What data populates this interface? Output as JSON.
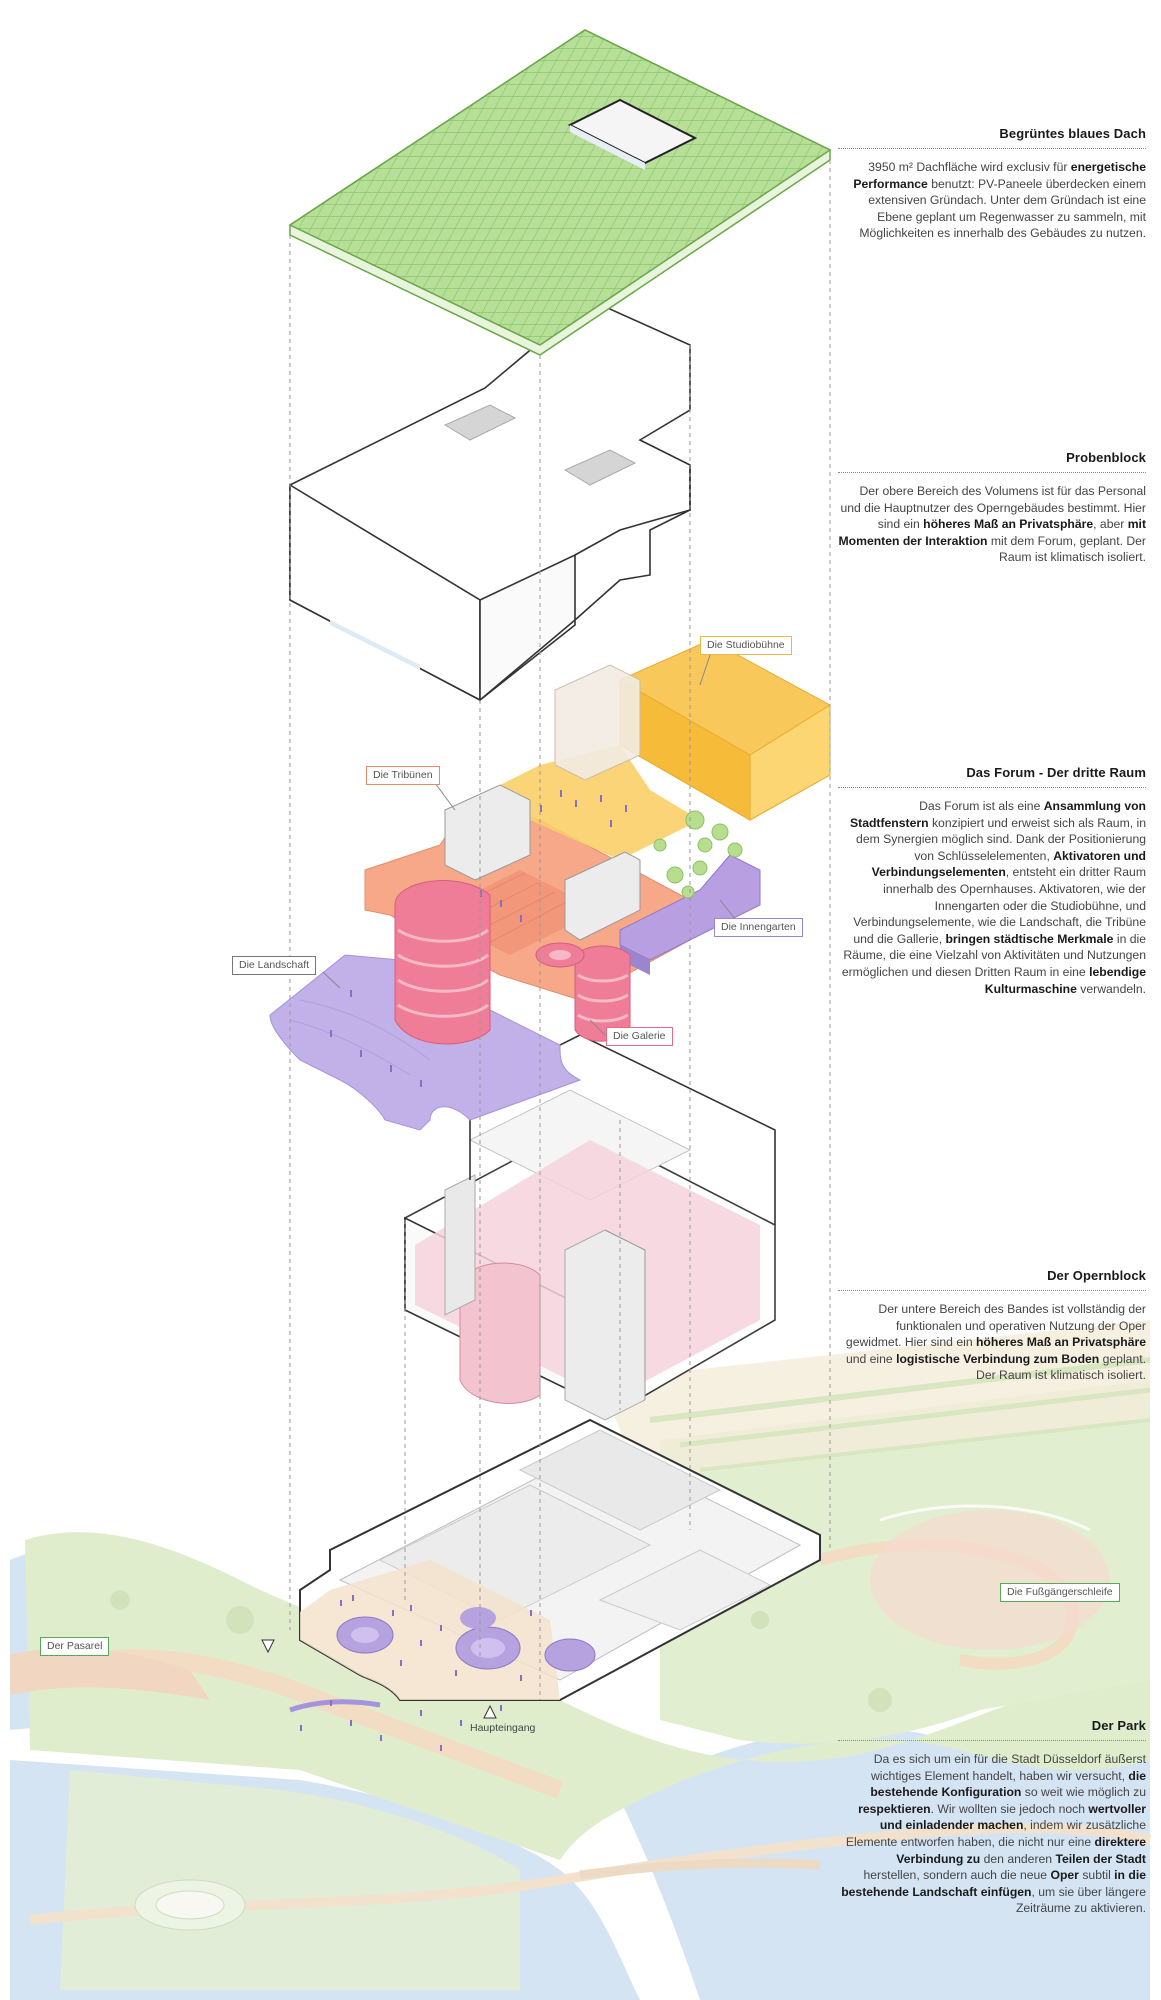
{
  "sections": [
    {
      "id": "roof",
      "title": "Begrüntes blaues Dach",
      "body": [
        {
          "t": "3950 m² Dachfläche wird exclusiv für "
        },
        {
          "t": "energetische Performance",
          "b": true
        },
        {
          "t": " benutzt: PV-Paneele überdecken einem extensiven Gründach. Unter dem Gründach ist eine Ebene geplant um Regenwasser zu sammeln, mit Möglichkeiten es innerhalb des Gebäudes zu nutzen."
        }
      ]
    },
    {
      "id": "probenblock",
      "title": "Probenblock",
      "body": [
        {
          "t": "Der obere Bereich des Volumens ist für das Personal und die Hauptnutzer des Operngebäudes bestimmt. Hier sind ein "
        },
        {
          "t": "höheres Maß an Privatsphäre",
          "b": true
        },
        {
          "t": ", aber "
        },
        {
          "t": "mit Momenten der Interaktion",
          "b": true
        },
        {
          "t": " mit dem Forum, geplant. Der Raum ist klimatisch isoliert."
        }
      ]
    },
    {
      "id": "forum",
      "title": "Das Forum - Der dritte Raum",
      "body": [
        {
          "t": "Das Forum ist als eine "
        },
        {
          "t": "Ansammlung von Stadtfenstern",
          "b": true
        },
        {
          "t": " konzipiert und erweist sich als Raum, in dem Synergien möglich sind. Dank der Positionierung von Schlüsselelementen, "
        },
        {
          "t": "Aktivatoren und Verbindungselementen",
          "b": true
        },
        {
          "t": ", entsteht ein dritter Raum innerhalb des Opernhauses. Aktivatoren, wie der Innengarten oder die Studiobühne, und Verbindungselemente, wie die Landschaft, die Tribüne und die Gallerie, "
        },
        {
          "t": "bringen städtische Merkmale",
          "b": true
        },
        {
          "t": " in die Räume, die eine Vielzahl von Aktivitäten und Nutzungen ermöglichen und diesen Dritten Raum in eine "
        },
        {
          "t": "lebendige Kulturmaschine",
          "b": true
        },
        {
          "t": " verwandeln."
        }
      ]
    },
    {
      "id": "opernblock",
      "title": "Der Opernblock",
      "body": [
        {
          "t": "Der untere Bereich des Bandes ist vollständig der funktionalen und operativen Nutzung der Oper gewidmet. Hier sind ein "
        },
        {
          "t": "höheres Maß an Privatsphäre",
          "b": true
        },
        {
          "t": " und eine "
        },
        {
          "t": "logistische Verbindung zum Boden",
          "b": true
        },
        {
          "t": " geplant. Der Raum ist klimatisch isoliert."
        }
      ]
    },
    {
      "id": "park",
      "title": "Der Park",
      "body": [
        {
          "t": "Da es sich um ein für die Stadt Düsseldorf äußerst wichtiges Element handelt, haben wir versucht, "
        },
        {
          "t": "die bestehende Konfiguration",
          "b": true
        },
        {
          "t": " so weit wie möglich zu "
        },
        {
          "t": "respektieren",
          "b": true
        },
        {
          "t": ". Wir wollten sie jedoch noch "
        },
        {
          "t": "wertvoller und einladender machen",
          "b": true
        },
        {
          "t": ", indem wir zusätzliche Elemente entworfen haben, die nicht nur eine "
        },
        {
          "t": "direktere Verbindung zu",
          "b": true
        },
        {
          "t": " den anderen "
        },
        {
          "t": "Teilen der Stadt",
          "b": true
        },
        {
          "t": " herstellen, sondern auch die neue "
        },
        {
          "t": "Oper",
          "b": true
        },
        {
          "t": " subtil "
        },
        {
          "t": "in die bestehende Landschaft einfügen",
          "b": true
        },
        {
          "t": ", um sie über längere Zeiträume zu aktivieren."
        }
      ]
    }
  ],
  "labels": {
    "studiobuehne": "Die Studiobühne",
    "tribuenen": "Die Tribünen",
    "innengarten": "Die Innengarten",
    "landschaft": "Die Landschaft",
    "galerie": "Die Galerie",
    "fussgaengerschleife": "Die Fußgängerschleife",
    "pasarel": "Der Pasarel",
    "haupteingang": "Haupteingang"
  },
  "colors": {
    "roof_green": "#a9d886",
    "roof_grid": "#7fbf5c",
    "forum_yellow": "#f8c95a",
    "forum_orange": "#f4a07e",
    "forum_purple": "#b9a3e3",
    "forum_pink": "#ef7d98",
    "opera_pink": "#f6d3dc",
    "park_green": "#dcebc8",
    "water_blue": "#cfe0f0",
    "path_beige": "#f4e4cf"
  }
}
